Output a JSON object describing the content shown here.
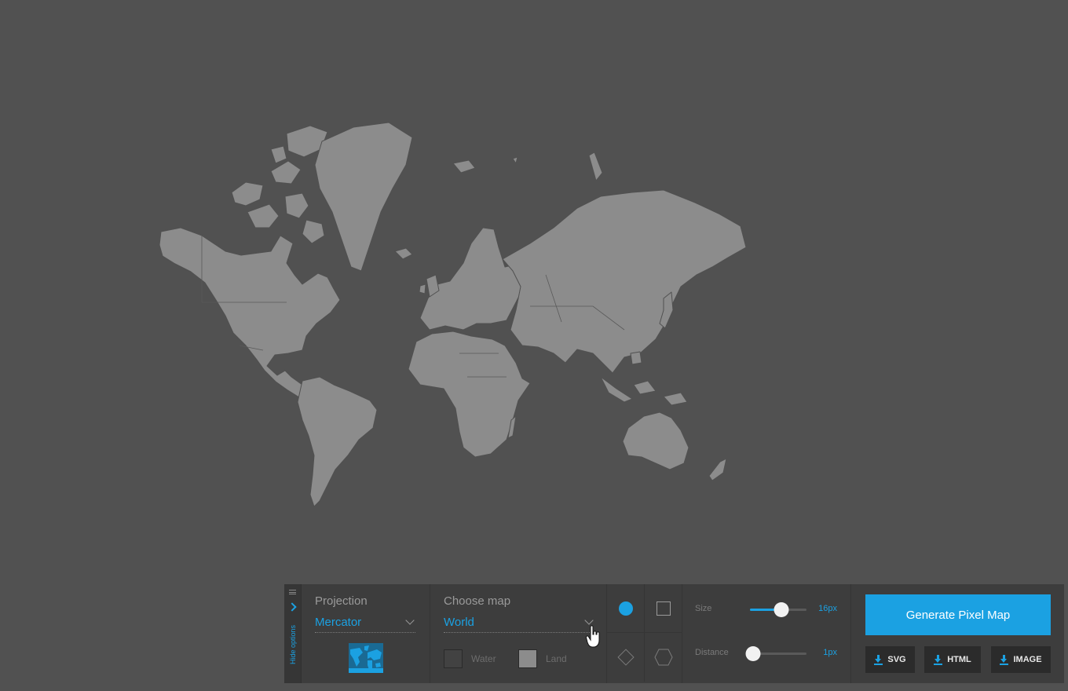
{
  "panel": {
    "hide_options_label": "Hide options",
    "projection": {
      "label": "Projection",
      "value": "Mercator"
    },
    "map": {
      "label": "Choose map",
      "value": "World",
      "water_label": "Water",
      "land_label": "Land"
    },
    "shapes": {
      "selected": "circle",
      "items": [
        "circle",
        "square",
        "diamond",
        "hexagon"
      ]
    },
    "size": {
      "label": "Size",
      "value_label": "16px",
      "level": 0.55
    },
    "distance": {
      "label": "Distance",
      "value_label": "1px",
      "level": 0.05
    },
    "generate_label": "Generate Pixel Map",
    "downloads": {
      "svg": "SVG",
      "html": "HTML",
      "image": "IMAGE"
    }
  },
  "colors": {
    "background": "#515151",
    "land": "#8c8c8c",
    "accent": "#1ba1e2",
    "panel": "#3d3d3d"
  }
}
